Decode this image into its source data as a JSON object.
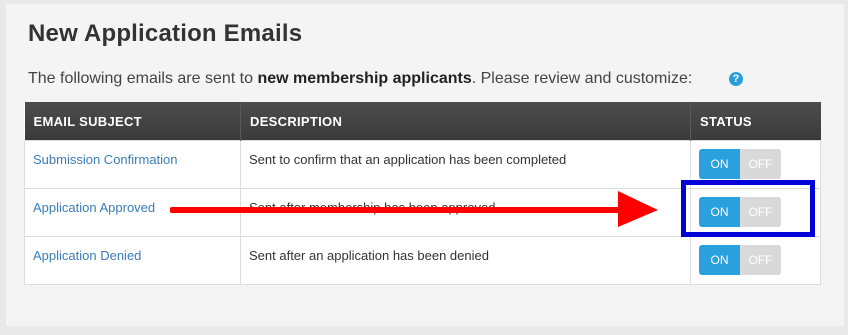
{
  "page": {
    "title": "New Application Emails",
    "intro_prefix": "The following emails are sent to ",
    "intro_bold": "new membership applicants",
    "intro_suffix": ". Please review and customize:",
    "help_icon_glyph": "?"
  },
  "table": {
    "headers": [
      "EMAIL SUBJECT",
      "DESCRIPTION",
      "STATUS"
    ],
    "rows": [
      {
        "subject": "Submission Confirmation",
        "description": "Sent to confirm that an application has been completed",
        "on_label": "ON",
        "off_label": "OFF",
        "status": "on"
      },
      {
        "subject": "Application Approved",
        "description": "Sent after membership has been approved",
        "on_label": "ON",
        "off_label": "OFF",
        "status": "on"
      },
      {
        "subject": "Application Denied",
        "description": "Sent after an application has been denied",
        "on_label": "ON",
        "off_label": "OFF",
        "status": "on"
      }
    ]
  },
  "annotations": {
    "arrow_color": "#ff0000",
    "box_color": "#0000d8"
  },
  "colors": {
    "toggle_on": "#2aa0dc",
    "toggle_off": "#d9d9d9",
    "link": "#3a7db8",
    "header_bg": "#3f3f3f"
  }
}
